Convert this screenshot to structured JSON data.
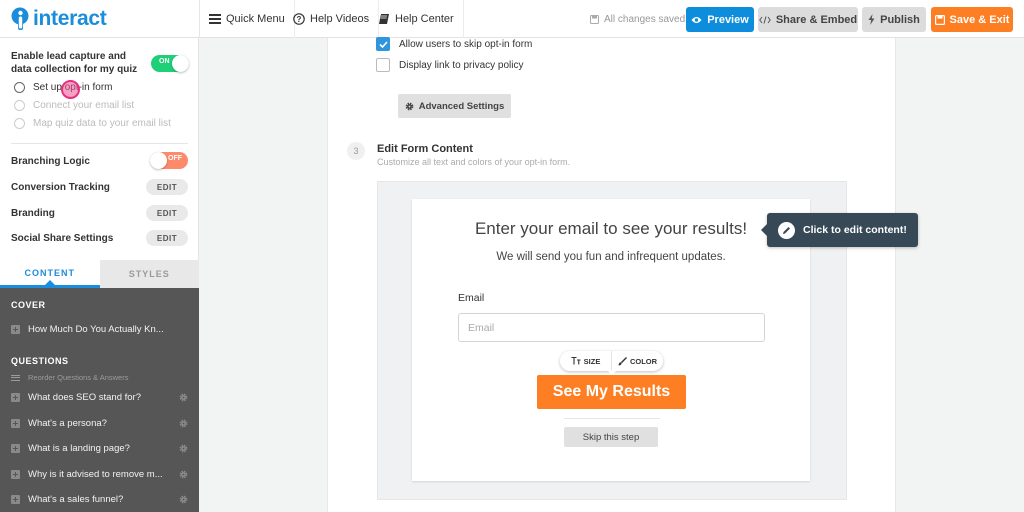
{
  "app": {
    "logo_text": "interact",
    "brand_color": "#1a8ddb"
  },
  "topbar": {
    "nav": [
      {
        "label": "Quick Menu",
        "icon": "hamburger-icon"
      },
      {
        "label": "Help Videos",
        "icon": "question-circle-icon"
      },
      {
        "label": "Help Center",
        "icon": "book-icon"
      }
    ],
    "save_status": "All changes saved",
    "buttons": {
      "preview": "Preview",
      "share": "Share & Embed",
      "publish": "Publish",
      "save_exit": "Save & Exit"
    },
    "colors": {
      "preview": "#0d8ddb",
      "save_exit": "#fd7e23"
    }
  },
  "sidebar": {
    "lead_capture": {
      "label": "Enable lead capture and data collection for my quiz",
      "toggle_state": "ON",
      "enabled": true
    },
    "lead_steps": [
      {
        "label": "Set up opt-in form",
        "enabled": true
      },
      {
        "label": "Connect your email list",
        "enabled": false
      },
      {
        "label": "Map quiz data to your email list",
        "enabled": false
      }
    ],
    "settings": [
      {
        "label": "Branching Logic",
        "control": "toggle",
        "value": "OFF"
      },
      {
        "label": "Conversion Tracking",
        "control": "button",
        "value": "EDIT"
      },
      {
        "label": "Branding",
        "control": "button",
        "value": "EDIT"
      },
      {
        "label": "Social Share Settings",
        "control": "button",
        "value": "EDIT"
      }
    ],
    "tabs": [
      {
        "label": "CONTENT",
        "active": true
      },
      {
        "label": "STYLES",
        "active": false
      }
    ],
    "outline": {
      "cover_heading": "COVER",
      "cover_item": "How Much Do You Actually Kn...",
      "questions_heading": "QUESTIONS",
      "reorder_label": "Reorder Questions & Answers",
      "questions": [
        "What does SEO stand for?",
        "What's a persona?",
        "What is a landing page?",
        "Why is it advised to remove m...",
        "What's a sales funnel?"
      ]
    }
  },
  "main": {
    "options": [
      {
        "label": "Allow users to skip opt-in form",
        "checked": true
      },
      {
        "label": "Display link to privacy policy",
        "checked": false
      }
    ],
    "advanced_settings": "Advanced Settings",
    "step": {
      "number": "3",
      "title": "Edit Form Content",
      "subtitle": "Customize all text and colors of your opt-in form."
    },
    "form_preview": {
      "title": "Enter your email to see your results!",
      "subtitle": "We will send you fun and infrequent updates.",
      "email_label": "Email",
      "email_placeholder": "Email",
      "email_value": "",
      "mini_toolbar": {
        "size": "SIZE",
        "color": "COLOR"
      },
      "cta": "See My Results",
      "cta_color": "#fd7e23",
      "skip": "Skip this step"
    },
    "tooltip": "Click to edit content!"
  }
}
